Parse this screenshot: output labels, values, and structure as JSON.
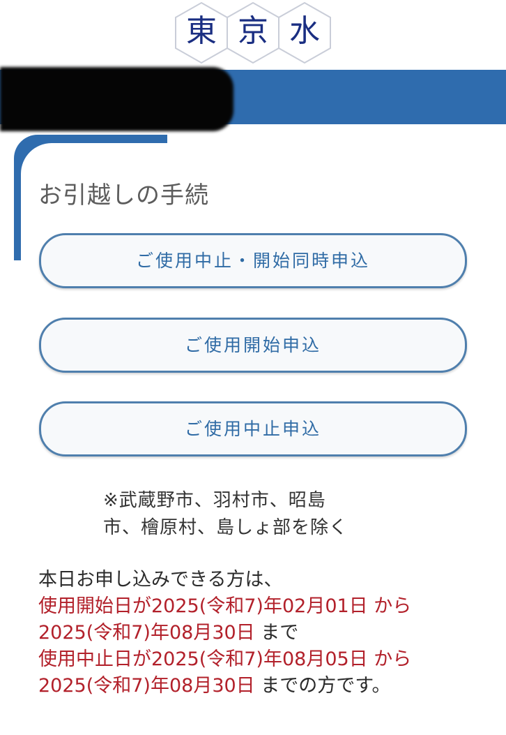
{
  "header": {
    "logo_chars": [
      "東",
      "京",
      "水"
    ],
    "redacted": true
  },
  "section": {
    "title": "お引越しの手続"
  },
  "buttons": {
    "stop_and_start": "ご使用中止・開始同時申込",
    "start": "ご使用開始申込",
    "stop": "ご使用中止申込"
  },
  "note": {
    "line1": "※武蔵野市、羽村市、昭島",
    "line2": "市、檜原村、島しょ部を除く"
  },
  "info": {
    "intro": "本日お申し込みできる方は、",
    "start_range_from": "使用開始日が2025(令和7)年02月01日 から",
    "start_range_to": "2025(令和7)年08月30日",
    "start_suffix": " まで",
    "stop_range_from": "使用中止日が2025(令和7)年08月05日 から",
    "stop_range_to": "2025(令和7)年08月30日",
    "stop_suffix": " までの方です。"
  },
  "colors": {
    "brand_blue": "#2f6cae",
    "button_text": "#2f6ba5",
    "highlight_red": "#b2202a",
    "logo_navy": "#1a2e82"
  }
}
